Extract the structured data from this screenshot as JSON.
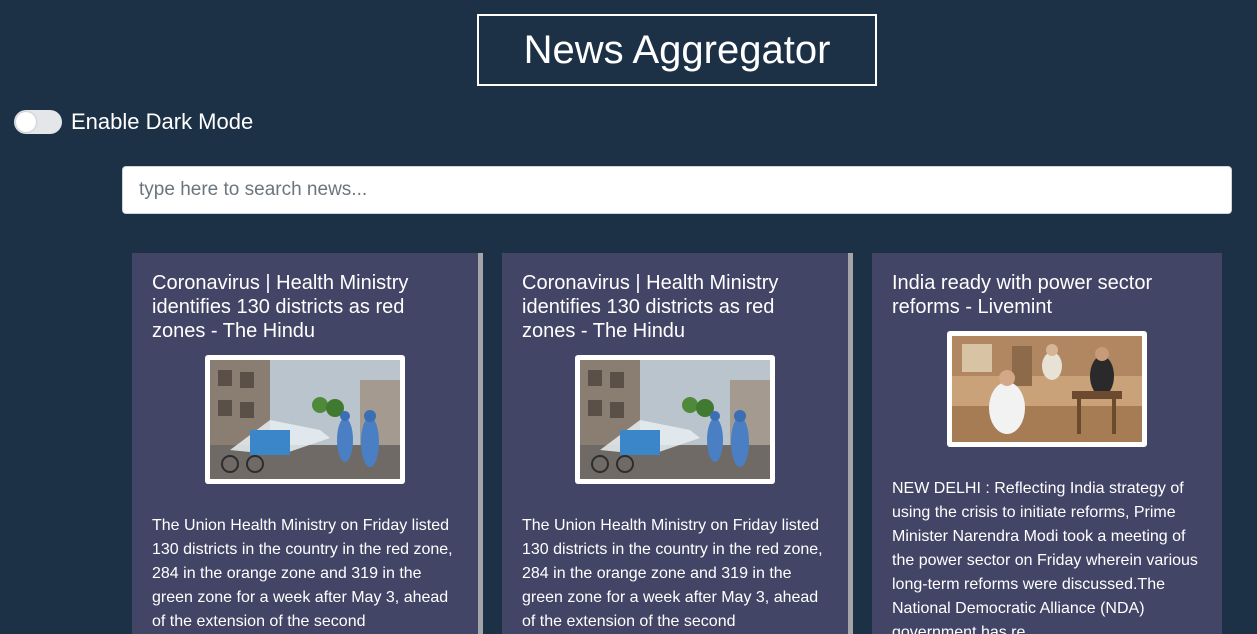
{
  "header": {
    "title": "News Aggregator"
  },
  "dark_mode": {
    "label": "Enable Dark Mode",
    "enabled": false
  },
  "search": {
    "placeholder": "type here to search news...",
    "value": ""
  },
  "articles": [
    {
      "title": "Coronavirus | Health Ministry identifies 130 districts as red zones - The Hindu",
      "image": "sanitization-workers-spraying-street-photo",
      "description": "The Union Health Ministry on Friday listed 130 districts in the country in the red zone, 284 in the orange zone and 319 in the green zone for a week after May 3, ahead of the extension of the second"
    },
    {
      "title": "Coronavirus | Health Ministry identifies 130 districts as red zones - The Hindu",
      "image": "sanitization-workers-spraying-street-photo",
      "description": "The Union Health Ministry on Friday listed 130 districts in the country in the red zone, 284 in the orange zone and 319 in the green zone for a week after May 3, ahead of the extension of the second"
    },
    {
      "title": "India ready with power sector reforms - Livemint",
      "image": "prime-minister-meeting-photo",
      "description": "NEW DELHI : Reflecting India strategy of using the crisis to initiate reforms, Prime Minister Narendra Modi took a meeting of the power sector on Friday wherein various long-term reforms were discussed.The National Democratic Alliance (NDA) government has re"
    }
  ],
  "colors": {
    "background": "#1c3146",
    "card": "#434566",
    "card_divider": "#a3a5aa",
    "text": "#ffffff"
  }
}
